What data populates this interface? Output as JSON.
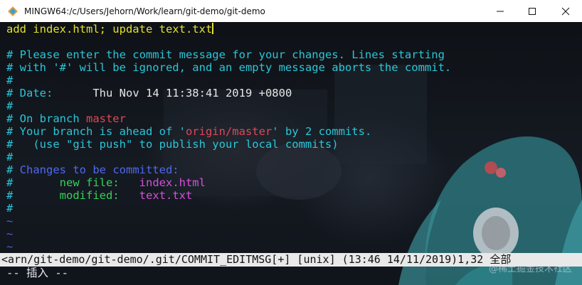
{
  "window": {
    "title": "MINGW64:/c/Users/Jehorn/Work/learn/git-demo/git-demo",
    "icon": "git-bash-icon",
    "controls": [
      "minimize-icon",
      "maximize-icon",
      "close-icon"
    ]
  },
  "editor": {
    "commit_message": "add index.html; update text.txt",
    "comments": {
      "l1": "# Please enter the commit message for your changes. Lines starting",
      "l2": "# with '#' will be ignored, and an empty message aborts the commit.",
      "l3": "#",
      "date_prefix": "# Date:      ",
      "date_value": "Thu Nov 14 11:38:41 2019 +0800",
      "l5": "#",
      "branch_prefix": "# On branch ",
      "branch_name": "master",
      "ahead_prefix": "# Your branch is ahead of '",
      "ahead_remote": "origin/master",
      "ahead_suffix": "' by 2 commits.",
      "push_hint": "#   (use \"git push\" to publish your local commits)",
      "l9": "#",
      "hash": "#",
      "changes_header": " Changes to be committed:",
      "new_file_label": "       new file:   ",
      "new_file_name": "index.html",
      "modified_label": "       modified:   ",
      "modified_name": "text.txt",
      "l13": "#"
    },
    "tilde": "~",
    "status_line": "<arn/git-demo/git-demo/.git/COMMIT_EDITMSG[+] [unix] (13:46 14/11/2019)1,32 全部",
    "mode_line": "-- 插入 --"
  },
  "watermark": "@稀土掘金技术社区",
  "colors": {
    "comment": "#2bc6d8",
    "text": "#e4e02e",
    "red": "#e04858",
    "blue": "#4f68f0",
    "green": "#35d35a",
    "magenta": "#d74fdc",
    "statusbar": "#e9e9e9"
  }
}
